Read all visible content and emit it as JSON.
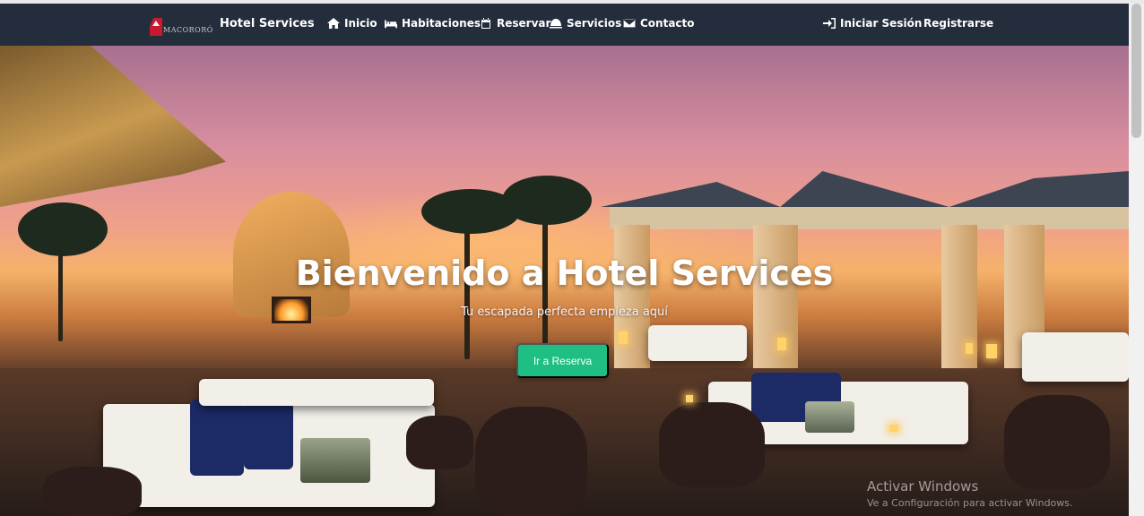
{
  "brand": {
    "logo_text": "MACORORÓ",
    "name": "Hotel Services"
  },
  "nav": {
    "items": [
      {
        "label": "Inicio",
        "icon": "home-icon"
      },
      {
        "label": "Habitaciones",
        "icon": "bed-icon"
      },
      {
        "label": "Reservar",
        "icon": "calendar-icon"
      },
      {
        "label": "Servicios",
        "icon": "bell-icon"
      },
      {
        "label": "Contacto",
        "icon": "envelope-icon"
      }
    ],
    "login": {
      "label": "Iniciar Sesión",
      "icon": "sign-in-icon"
    },
    "register": {
      "label": "Registrarse"
    }
  },
  "hero": {
    "title": "Bienvenido a Hotel Services",
    "subtitle": "Tu escapada perfecta empieza aquí",
    "cta_label": "Ir a Reserva"
  },
  "watermark": {
    "line1": "Activar Windows",
    "line2": "Ve a Configuración para activar Windows."
  },
  "colors": {
    "navbar": "#232d3c",
    "cta": "#1fbf84",
    "brand_red": "#c8192e"
  }
}
